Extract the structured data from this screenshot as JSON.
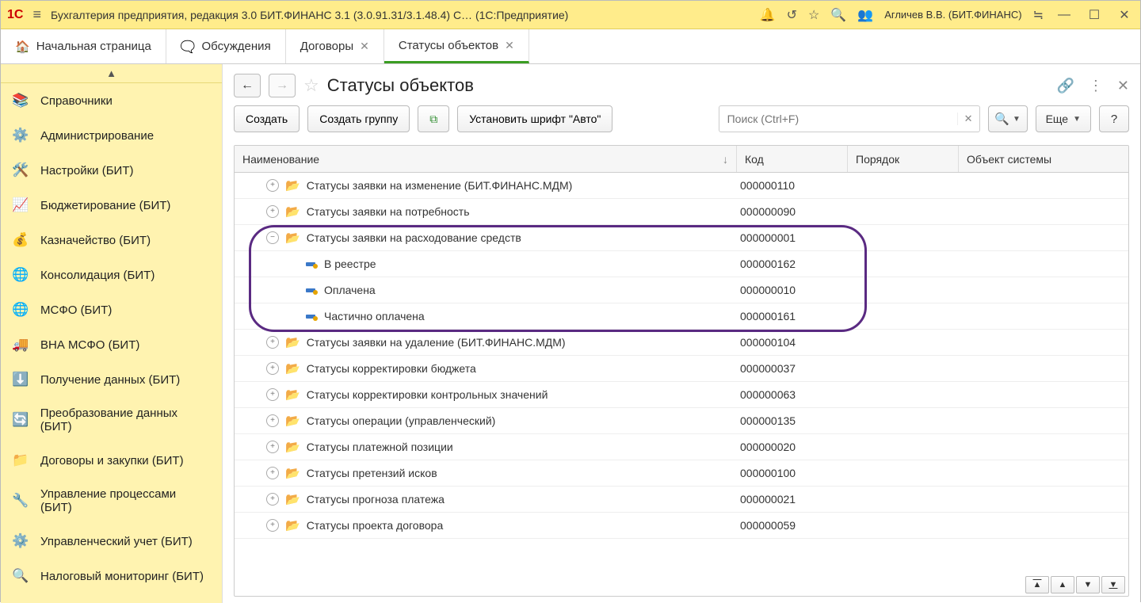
{
  "titlebar": {
    "app_title": "Бухгалтерия предприятия, редакция 3.0  БИТ.ФИНАНС 3.1 (3.0.91.31/3.1.48.4) С…   (1С:Предприятие)",
    "user": "Агличев В.В. (БИТ.ФИНАНС)"
  },
  "tabs": [
    {
      "label": "Начальная страница",
      "closable": false,
      "home": true
    },
    {
      "label": "Обсуждения",
      "closable": false,
      "home": false
    },
    {
      "label": "Договоры",
      "closable": true,
      "home": false
    },
    {
      "label": "Статусы объектов",
      "closable": true,
      "home": false,
      "active": true
    }
  ],
  "sidebar": {
    "items": [
      {
        "icon": "books",
        "label": "Справочники"
      },
      {
        "icon": "gear",
        "label": "Администрирование"
      },
      {
        "icon": "tools",
        "label": "Настройки (БИТ)"
      },
      {
        "icon": "chart",
        "label": "Бюджетирование (БИТ)"
      },
      {
        "icon": "money",
        "label": "Казначейство (БИТ)"
      },
      {
        "icon": "globe",
        "label": "Консолидация (БИТ)"
      },
      {
        "icon": "globe",
        "label": "МСФО (БИТ)"
      },
      {
        "icon": "truck",
        "label": "ВНА МСФО (БИТ)"
      },
      {
        "icon": "download",
        "label": "Получение данных (БИТ)"
      },
      {
        "icon": "sync",
        "label": "Преобразование данных (БИТ)"
      },
      {
        "icon": "folder",
        "label": "Договоры и закупки (БИТ)"
      },
      {
        "icon": "process",
        "label": "Управление процессами (БИТ)"
      },
      {
        "icon": "gear2",
        "label": "Управленческий учет (БИТ)"
      },
      {
        "icon": "search",
        "label": "Налоговый мониторинг (БИТ)"
      }
    ]
  },
  "page": {
    "title": "Статусы объектов",
    "toolbar": {
      "create": "Создать",
      "create_group": "Создать группу",
      "set_font": "Установить шрифт \"Авто\"",
      "more": "Еще",
      "help": "?"
    },
    "search": {
      "placeholder": "Поиск (Ctrl+F)"
    }
  },
  "table": {
    "columns": {
      "name": "Наименование",
      "code": "Код",
      "order": "Порядок",
      "obj": "Объект системы"
    },
    "rows": [
      {
        "type": "folder",
        "expanded": false,
        "indent": 1,
        "name": "Статусы заявки на изменение (БИТ.ФИНАНС.МДМ)",
        "code": "000000110"
      },
      {
        "type": "folder",
        "expanded": false,
        "indent": 1,
        "name": "Статусы заявки на потребность",
        "code": "000000090"
      },
      {
        "type": "folder",
        "expanded": true,
        "indent": 1,
        "name": "Статусы заявки на расходование средств",
        "code": "000000001"
      },
      {
        "type": "item",
        "indent": 2,
        "name": "В реестре",
        "code": "000000162"
      },
      {
        "type": "item",
        "indent": 2,
        "name": "Оплачена",
        "code": "000000010"
      },
      {
        "type": "item",
        "indent": 2,
        "name": "Частично оплачена",
        "code": "000000161"
      },
      {
        "type": "folder",
        "expanded": false,
        "indent": 1,
        "name": "Статусы заявки на удаление (БИТ.ФИНАНС.МДМ)",
        "code": "000000104"
      },
      {
        "type": "folder",
        "expanded": false,
        "indent": 1,
        "name": "Статусы корректировки бюджета",
        "code": "000000037"
      },
      {
        "type": "folder",
        "expanded": false,
        "indent": 1,
        "name": "Статусы корректировки контрольных значений",
        "code": "000000063"
      },
      {
        "type": "folder",
        "expanded": false,
        "indent": 1,
        "name": "Статусы операции (управленческий)",
        "code": "000000135"
      },
      {
        "type": "folder",
        "expanded": false,
        "indent": 1,
        "name": "Статусы платежной позиции",
        "code": "000000020"
      },
      {
        "type": "folder",
        "expanded": false,
        "indent": 1,
        "name": "Статусы претензий исков",
        "code": "000000100"
      },
      {
        "type": "folder",
        "expanded": false,
        "indent": 1,
        "name": "Статусы прогноза платежа",
        "code": "000000021"
      },
      {
        "type": "folder",
        "expanded": false,
        "indent": 1,
        "name": "Статусы проекта договора",
        "code": "000000059"
      }
    ]
  }
}
